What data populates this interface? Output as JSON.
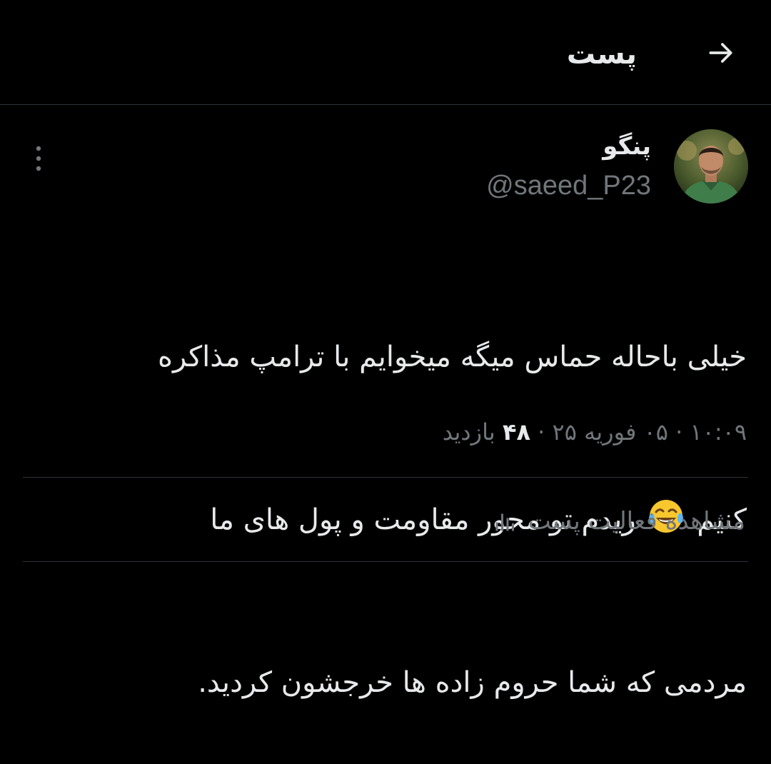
{
  "header": {
    "title": "پست",
    "back_icon": "arrow-right-icon"
  },
  "author": {
    "display_name": "پنگو",
    "handle": "@saeed_P23",
    "avatar_icon": "user-avatar"
  },
  "more_icon": "vertical-dots-icon",
  "tweet": {
    "line1": "خیلی باحاله حماس میگه میخوایم با ترامپ مذاکره",
    "line2_before": "کنیم",
    "line2_emoji": "tears-of-joy-emoji",
    "line2_after": "ریدم تو محور مقاومت و پول های ما",
    "line3": "مردمی که شما حروم زاده ها خرجشون کردید."
  },
  "meta": {
    "time": "۱۰:۰۹",
    "separator": "·",
    "date": "۰۵ فوریه ۲۵",
    "views_count": "۴۸",
    "views_label": "بازدید"
  },
  "activity": {
    "label": "مشاهده فعالیت پست",
    "icon": "bar-chart-icon"
  },
  "colors": {
    "background": "#000000",
    "text_primary": "#e7e9ea",
    "text_secondary": "#71767b",
    "divider": "#2f3336"
  }
}
